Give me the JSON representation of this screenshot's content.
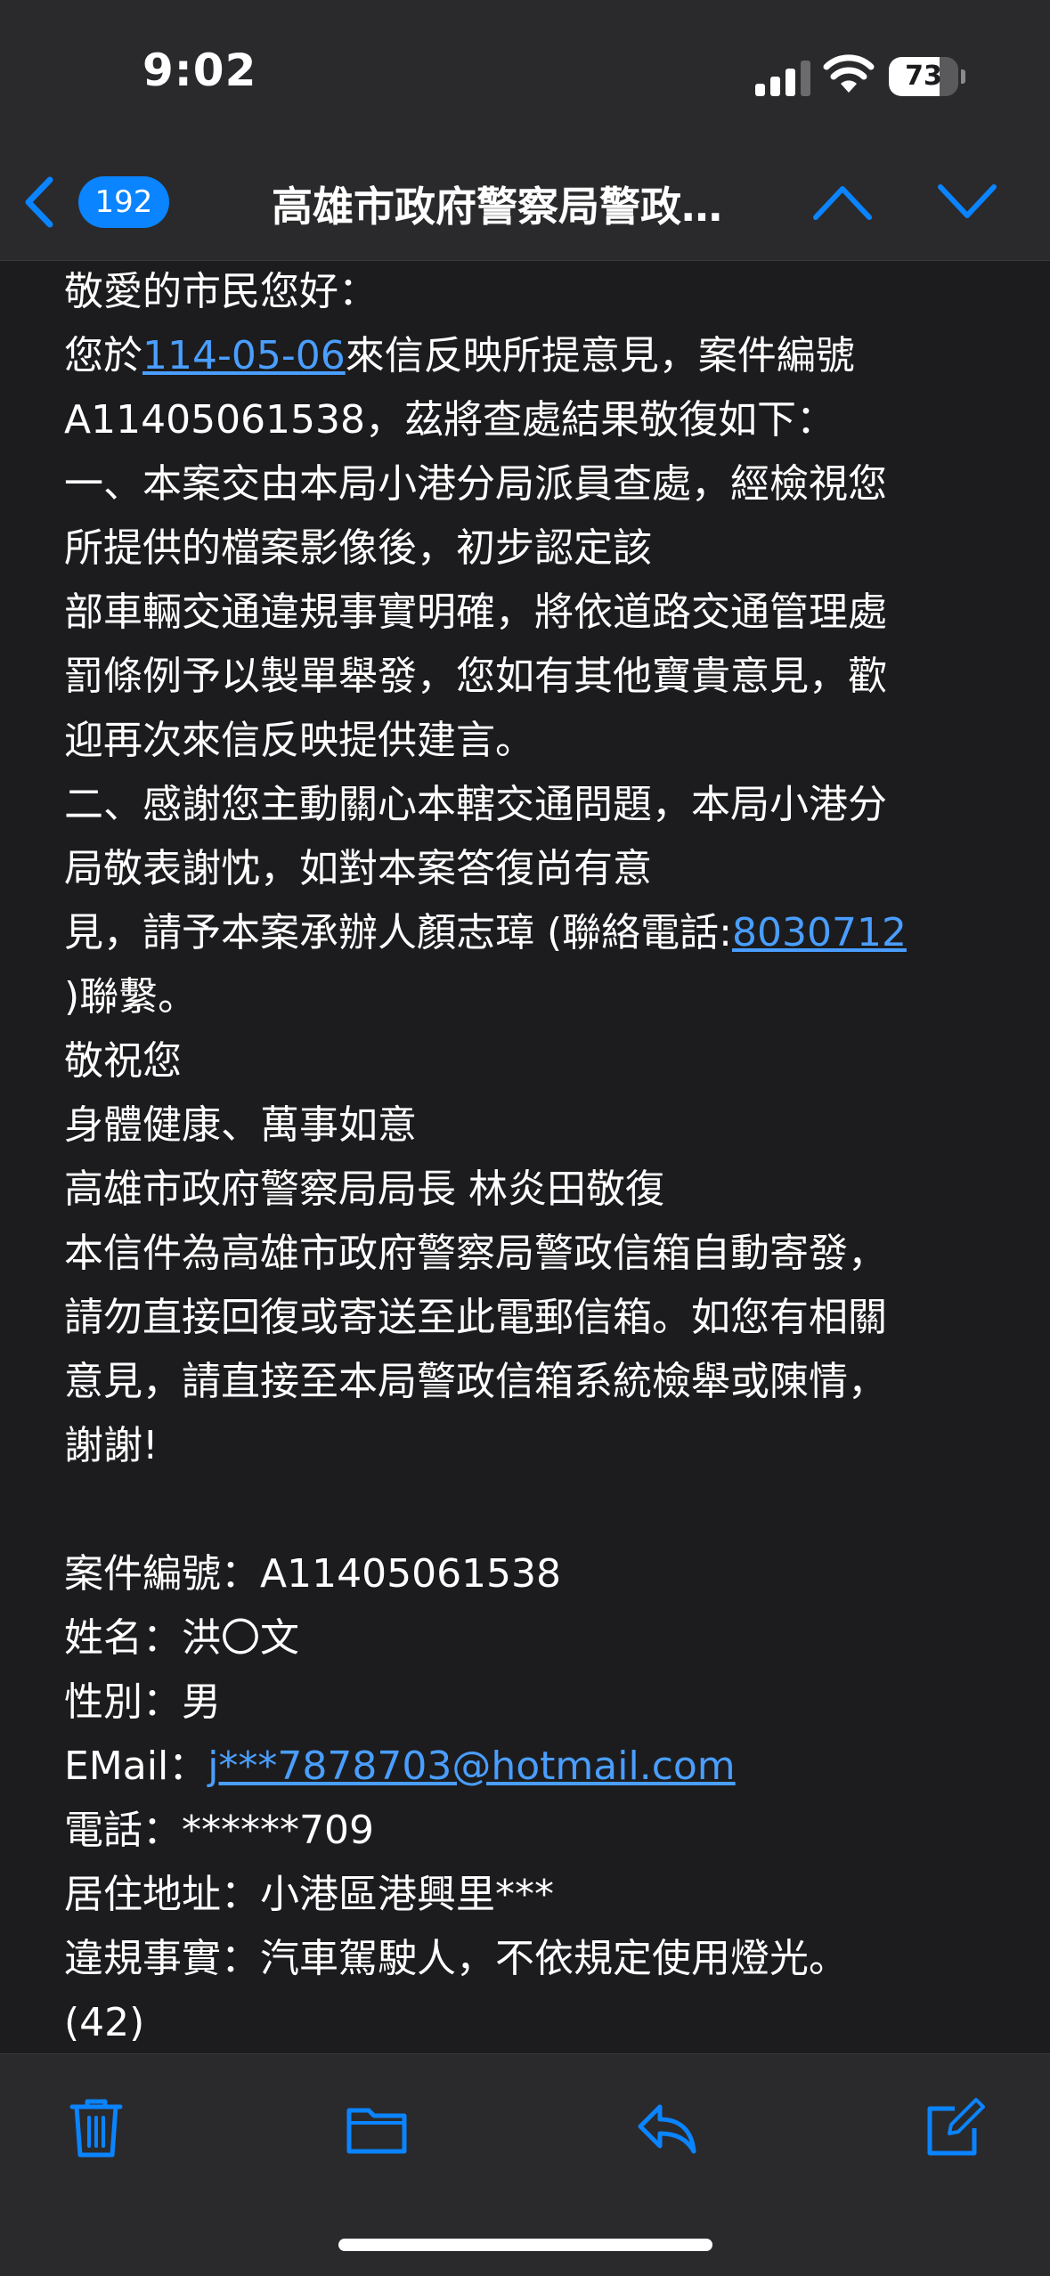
{
  "status_bar": {
    "time": "9:02",
    "battery": "73",
    "battery_level": 0.73
  },
  "nav": {
    "unread_count": "192",
    "title": "高雄市政府警察局警政…"
  },
  "message": {
    "lines": [
      {
        "type": "text",
        "text": "敬愛的市民您好："
      },
      {
        "type": "mixed",
        "before": "您於",
        "link": "114-05-06",
        "after": "來信反映所提意見，案件編號"
      },
      {
        "type": "text",
        "text": "A11405061538，茲將查處結果敬復如下："
      },
      {
        "type": "text",
        "text": "一、本案交由本局小港分局派員查處，經檢視您"
      },
      {
        "type": "text",
        "text": "所提供的檔案影像後，初步認定該"
      },
      {
        "type": "text",
        "text": "部車輛交通違規事實明確，將依道路交通管理處"
      },
      {
        "type": "text",
        "text": "罰條例予以製單舉發，您如有其他寶貴意見，歡"
      },
      {
        "type": "text",
        "text": "迎再次來信反映提供建言。"
      },
      {
        "type": "text",
        "text": "二、感謝您主動關心本轄交通問題，本局小港分"
      },
      {
        "type": "text",
        "text": "局敬表謝忱，如對本案答復尚有意"
      },
      {
        "type": "mixed",
        "before": "見，請予本案承辦人顏志璋 (聯絡電話:",
        "link": "8030712",
        "after": ""
      },
      {
        "type": "text",
        "text": ")聯繫。"
      },
      {
        "type": "text",
        "text": "敬祝您"
      },
      {
        "type": "text",
        "text": "身體健康、萬事如意"
      },
      {
        "type": "text",
        "text": "高雄市政府警察局局長 林炎田敬復"
      },
      {
        "type": "text",
        "text": "本信件為高雄市政府警察局警政信箱自動寄發，"
      },
      {
        "type": "text",
        "text": "請勿直接回復或寄送至此電郵信箱。如您有相關"
      },
      {
        "type": "text",
        "text": "意見，請直接至本局警政信箱系統檢舉或陳情，"
      },
      {
        "type": "text",
        "text": "謝謝!"
      },
      {
        "type": "blank",
        "text": ""
      },
      {
        "type": "text",
        "text": "案件編號：A11405061538"
      },
      {
        "type": "text",
        "text": "姓名：洪〇文"
      },
      {
        "type": "text",
        "text": "性別：男"
      },
      {
        "type": "mixed",
        "before": "EMail：",
        "link": "j***7878703@hotmail.com",
        "after": ""
      },
      {
        "type": "text",
        "text": "電話：******709"
      },
      {
        "type": "text",
        "text": "居住地址：小港區港興里***"
      },
      {
        "type": "text",
        "text": "違規事實：汽車駕駛人，不依規定使用燈光。"
      },
      {
        "type": "text",
        "text": "(42)"
      }
    ]
  },
  "toolbar": {
    "icons": [
      "trash-icon",
      "folder-icon",
      "reply-icon",
      "compose-icon"
    ]
  },
  "colors": {
    "accent": "#0a84ff",
    "link": "#4a9eff",
    "background": "#1c1c1e",
    "bar": "#2a2a2c"
  }
}
